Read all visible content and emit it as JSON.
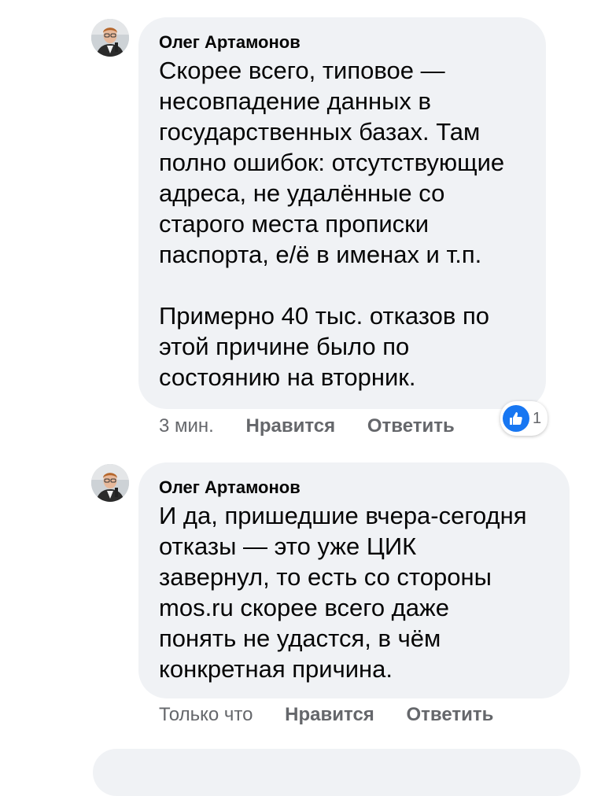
{
  "comments": [
    {
      "author": "Олег Артамонов",
      "text": "Скорее всего, типовое —\nнесовпадение данных в\nгосударственных базах. Там\nполно ошибок: отсутствующие\nадреса, не удалённые со\nстарого места прописки\nпаспорта, е/ё в именах и т.п.\n\nПримерно 40 тыс. отказов по\nэтой причине было по\nсостоянию на вторник.",
      "time": "3 мин.",
      "like_label": "Нравится",
      "reply_label": "Ответить",
      "reaction_icon": "thumbs-up-icon",
      "reaction_count": "1"
    },
    {
      "author": "Олег Артамонов",
      "text": "И да, пришедшие вчера-сегодня\nотказы — это уже ЦИК\nзавернул, то есть со стороны\nmos.ru скорее всего даже\nпонять не удастся, в чём\nконкретная причина.",
      "time": "Только что",
      "like_label": "Нравится",
      "reply_label": "Ответить"
    }
  ],
  "colors": {
    "bubble_bg": "#f0f2f5",
    "meta_text": "#65676b",
    "like_blue": "#1877f2"
  }
}
